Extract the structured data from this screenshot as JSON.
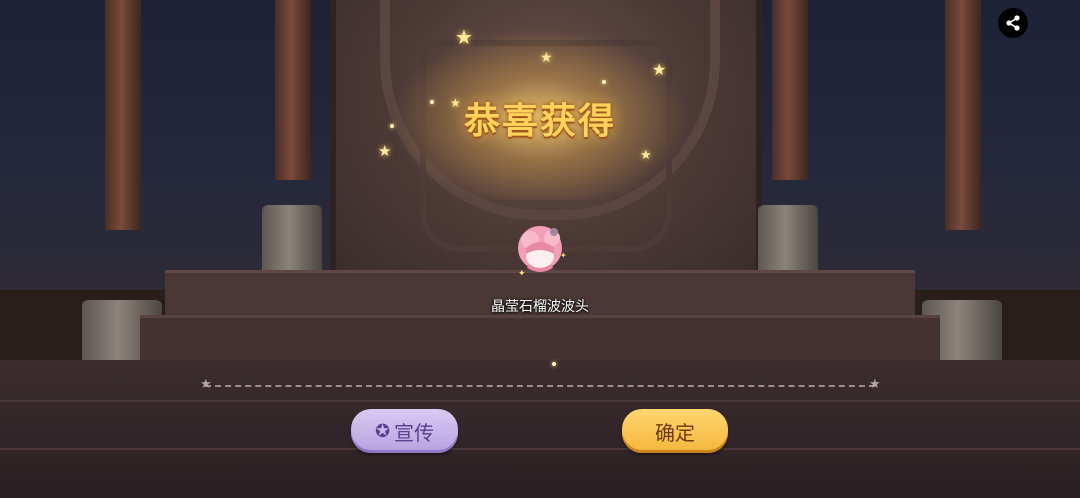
{
  "popup": {
    "title": "恭喜获得",
    "item_name": "晶莹石榴波波头",
    "item_icon": "pink-hair-bob-icon"
  },
  "buttons": {
    "promote_label": "宣传",
    "promote_icon": "star-badge-icon",
    "confirm_label": "确定"
  },
  "share": {
    "icon": "share-icon"
  },
  "colors": {
    "title": "#ffd35a",
    "promote_button": "#c4b2ea",
    "confirm_button": "#f8c24e"
  }
}
